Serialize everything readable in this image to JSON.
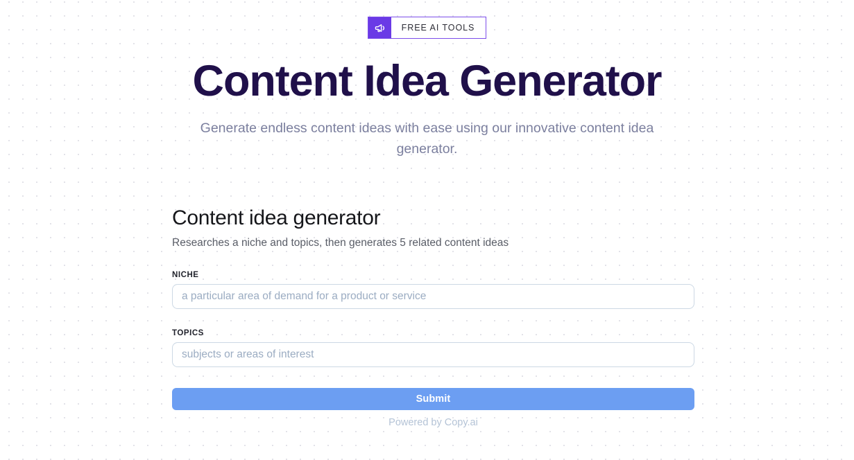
{
  "badge": {
    "icon": "megaphone-icon",
    "label": "FREE AI TOOLS",
    "icon_bg_color": "#6a3ae6",
    "border_color": "#7c4dea"
  },
  "hero": {
    "title": "Content Idea Generator",
    "subtitle": "Generate endless content ideas with ease using our innovative content idea generator.",
    "title_color": "#20104a",
    "subtitle_color": "#7b7f9e"
  },
  "form": {
    "title": "Content idea generator",
    "description": "Researches a niche and topics, then generates 5 related content ideas",
    "fields": [
      {
        "label": "NICHE",
        "placeholder": "a particular area of demand for a product or service",
        "value": ""
      },
      {
        "label": "TOPICS",
        "placeholder": "subjects or areas of interest",
        "value": ""
      }
    ],
    "submit_label": "Submit",
    "submit_color": "#6c9ef2",
    "powered_by": "Powered by Copy.ai"
  }
}
